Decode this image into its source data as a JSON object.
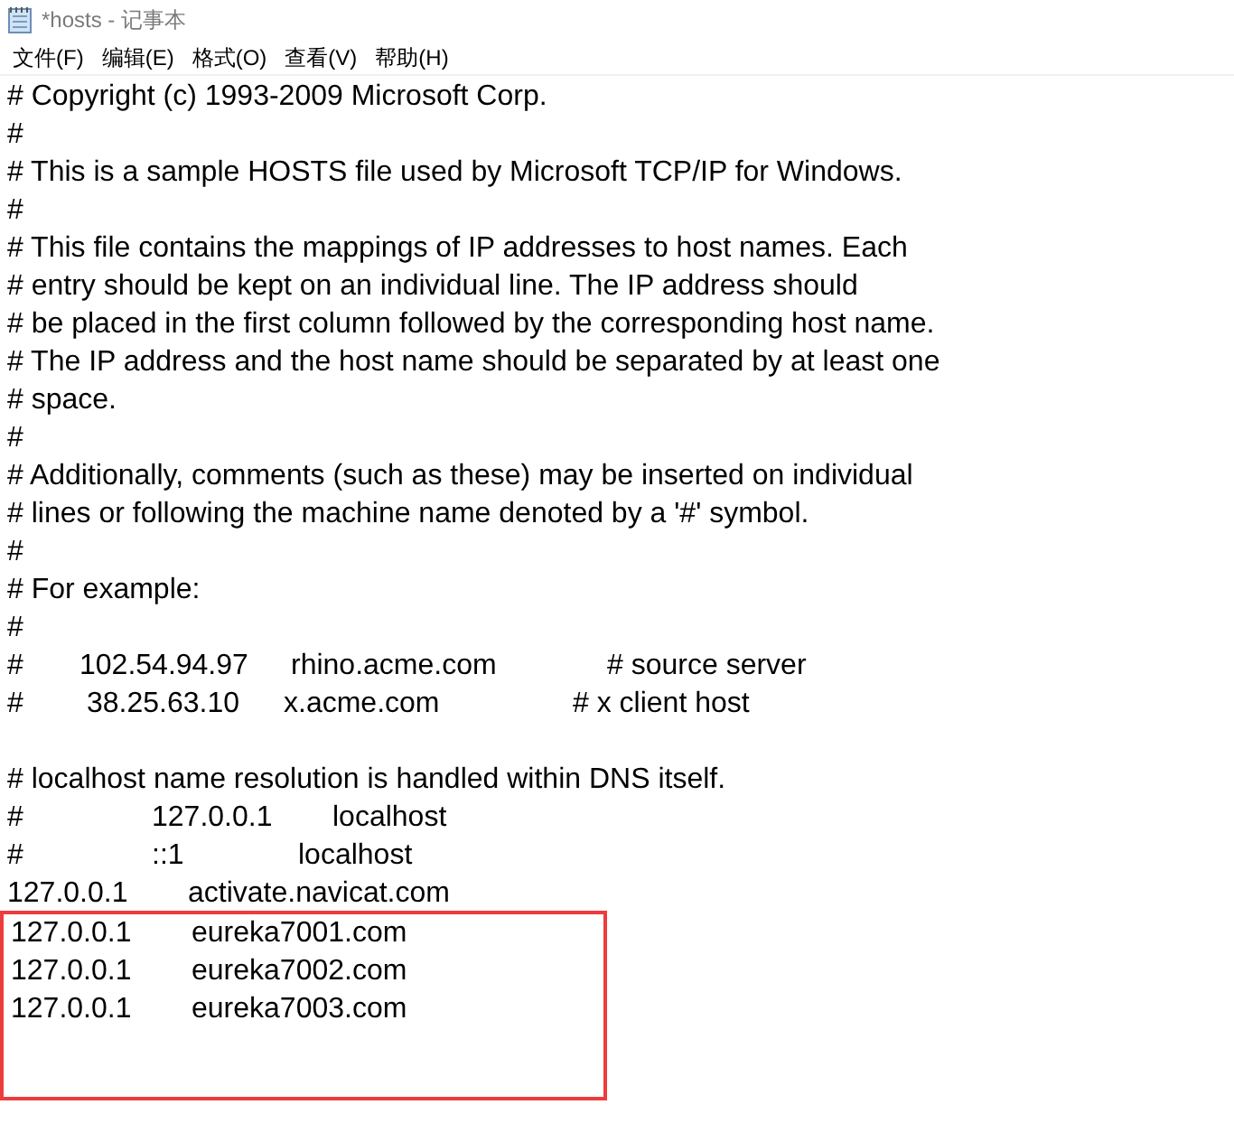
{
  "window": {
    "title": "*hosts - 记事本"
  },
  "menu": [
    "文件(F)",
    "编辑(E)",
    "格式(O)",
    "查看(V)",
    "帮助(H)"
  ],
  "lines": [
    {
      "kind": "text",
      "parts": [
        "# Copyright (c) 1993-2009 Microsoft Corp."
      ]
    },
    {
      "kind": "text",
      "parts": [
        "#"
      ]
    },
    {
      "kind": "text",
      "parts": [
        "# This is a sample HOSTS file used by Microsoft TCP/IP for Windows."
      ]
    },
    {
      "kind": "text",
      "parts": [
        "#"
      ]
    },
    {
      "kind": "text",
      "parts": [
        "# This file contains the mappings of IP addresses to host names. Each"
      ]
    },
    {
      "kind": "text",
      "parts": [
        "# entry should be kept on an individual line. The IP address should"
      ]
    },
    {
      "kind": "text",
      "parts": [
        "# be placed in the first column followed by the corresponding host name."
      ]
    },
    {
      "kind": "text",
      "parts": [
        "# The IP address and the host name should be separated by at least one"
      ]
    },
    {
      "kind": "text",
      "parts": [
        "# space."
      ]
    },
    {
      "kind": "text",
      "parts": [
        "#"
      ]
    },
    {
      "kind": "text",
      "parts": [
        "# Additionally, comments (such as these) may be inserted on individual"
      ]
    },
    {
      "kind": "text",
      "parts": [
        "# lines or following the machine name denoted by a '#' symbol."
      ]
    },
    {
      "kind": "text",
      "parts": [
        "#"
      ]
    },
    {
      "kind": "text",
      "parts": [
        "# For example:"
      ]
    },
    {
      "kind": "text",
      "parts": [
        "#"
      ]
    },
    {
      "kind": "example",
      "parts": [
        "#",
        "102.54.94.97",
        "rhino.acme.com",
        "# source server"
      ]
    },
    {
      "kind": "example2",
      "parts": [
        "#",
        "38.25.63.10",
        "x.acme.com",
        "# x client host"
      ]
    },
    {
      "kind": "blank"
    },
    {
      "kind": "text",
      "parts": [
        "# localhost name resolution is handled within DNS itself."
      ]
    },
    {
      "kind": "loopback",
      "parts": [
        "#",
        "127.0.0.1",
        "localhost"
      ]
    },
    {
      "kind": "loopback2",
      "parts": [
        "#",
        "::1",
        "localhost"
      ]
    },
    {
      "kind": "entry",
      "parts": [
        "127.0.0.1",
        "activate.navicat.com"
      ],
      "highlighted": false
    },
    {
      "kind": "entry",
      "parts": [
        "127.0.0.1",
        "eureka7001.com"
      ],
      "highlighted": true
    },
    {
      "kind": "entry",
      "parts": [
        "127.0.0.1",
        "eureka7002.com"
      ],
      "highlighted": true
    },
    {
      "kind": "entry",
      "parts": [
        "127.0.0.1",
        "eureka7003.com"
      ],
      "highlighted": true
    }
  ]
}
